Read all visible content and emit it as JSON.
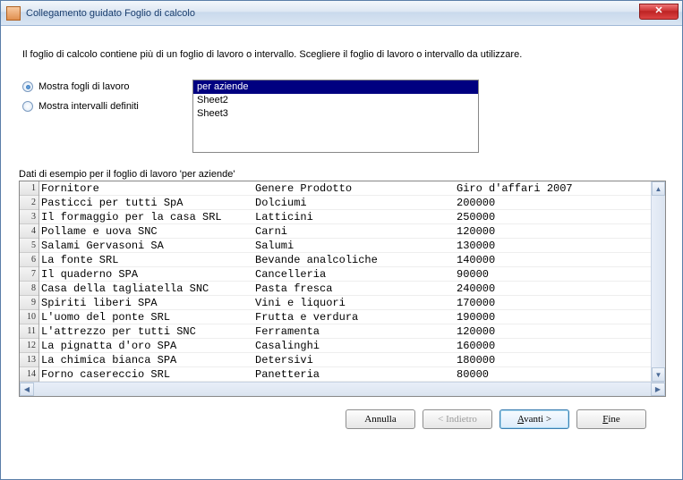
{
  "window": {
    "title": "Collegamento guidato Foglio di calcolo"
  },
  "instruction": "Il foglio di calcolo contiene più di un foglio di lavoro o intervallo. Scegliere il foglio di lavoro o intervallo da utilizzare.",
  "options": {
    "show_worksheets": "Mostra fogli di lavoro",
    "show_ranges": "Mostra intervalli definiti",
    "selected": "show_worksheets"
  },
  "sheet_list": {
    "items": [
      "per aziende",
      "Sheet2",
      "Sheet3"
    ],
    "selected_index": 0
  },
  "sample": {
    "label": "Dati di esempio per il foglio di lavoro 'per aziende'",
    "rows": [
      [
        "Fornitore",
        "Genere Prodotto",
        "Giro d'affari 2007"
      ],
      [
        "Pasticci per tutti SpA",
        "Dolciumi",
        "200000"
      ],
      [
        "Il formaggio per la casa SRL",
        "Latticini",
        "250000"
      ],
      [
        "Pollame e uova SNC",
        "Carni",
        "120000"
      ],
      [
        "Salami Gervasoni SA",
        "Salumi",
        "130000"
      ],
      [
        "La fonte SRL",
        "Bevande analcoliche",
        "140000"
      ],
      [
        "Il quaderno SPA",
        "Cancelleria",
        "90000"
      ],
      [
        "Casa della tagliatella SNC",
        "Pasta fresca",
        "240000"
      ],
      [
        "Spiriti liberi SPA",
        "Vini e liquori",
        "170000"
      ],
      [
        "L'uomo del ponte SRL",
        "Frutta e verdura",
        "190000"
      ],
      [
        "L'attrezzo per tutti SNC",
        "Ferramenta",
        "120000"
      ],
      [
        "La pignatta d'oro SPA",
        "Casalinghi",
        "160000"
      ],
      [
        "La chimica bianca SPA",
        "Detersivi",
        "180000"
      ],
      [
        "Forno casereccio SRL",
        "Panetteria",
        "80000"
      ]
    ]
  },
  "buttons": {
    "cancel": "Annulla",
    "back": "< Indietro",
    "next": "Avanti >",
    "finish": "Fine"
  }
}
